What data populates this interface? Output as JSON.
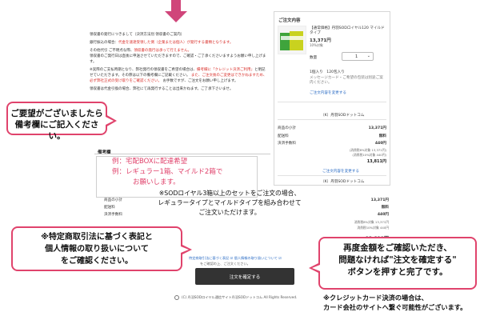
{
  "receipt_notice": {
    "title": "領収書の発行につきまして（決済方法別 領収書のご案内）",
    "bank_prefix": "銀行振込の場合：",
    "bank_red": "代金を速達受領した側（企業または個人）が発行する書類となります。",
    "bank_suffix": "",
    "cod_prefix": "その他代引 ご不明点な際、",
    "cod_red": "領収書の発行は承って行えません。",
    "cod_suffix": "",
    "line3": "領収書のご発行日は直後に申送させていただきますので、ご確認・ご了承くださいますようお願い申し上げます。",
    "line4_prefix": "※実際のご支払時期となり、弊社発行の領収書をご希望の場合は、",
    "line4_red": "備考欄に「クレジット決済ご利用」",
    "line4_suffix": "と明記せていただきます。その際は以下の備考欄にご記載ください。",
    "line5_red": "また、ご注文後のご変更はできかねますため、必ず弊社正式の受け取りをご確認ください。",
    "line6": "お手数ですが、ご注文をお願い申し上げます。",
    "line7": "領収書は代金引換の場合、弊社にて再発行することは出来かねます。ご了承下さいませ。"
  },
  "callouts": {
    "remarks_line1": "ご要望がございましたら",
    "remarks_line2": "備考欄にご記入ください。",
    "legal_line1": "※特定商取引法に基づく表記と",
    "legal_line2": "個人情報の取り扱いについて",
    "legal_line3": "をご確認ください。",
    "confirm_line1": "再度金額をご確認いただき、",
    "confirm_line2": "問題なければ\"注文を確定する\"",
    "confirm_line3": "ボタンを押すと完了です。",
    "card_note_line1": "※クレジットカード決済の場合は、",
    "card_note_line2": "カード会社のサイトへ繋ぐ可能性がございます。"
  },
  "order": {
    "title": "ご注文内容",
    "product_name": "【通常価格】丹羽SODロイヤル120 マイルドタイプ",
    "price": "13,371円",
    "tax_note": "10%対象",
    "qty_label": "数量",
    "qty_value": "1",
    "content": "1個入り　120包入り",
    "meta": "メッセージカード・ご希望の包装は別途ご案内ください。",
    "change_link": "ご注文内容を変更する",
    "store": "（K）丹羽SODドットコム",
    "subtotal_label": "商品の小計",
    "subtotal_value": "13,371円",
    "shipping_label": "配送料",
    "shipping_value": "無料",
    "fee_label": "決済手数料",
    "fee_value": "440円",
    "tax_line1": "(消費税8%対象 13,371円)",
    "tax_line2": "(消費税10%対象 440円)",
    "total_value": "13,811円",
    "change_link2": "ご注文内容を変更する",
    "store2": "（K）丹羽SODドットコム"
  },
  "remarks": {
    "heading": "備考欄",
    "ph_line1": "例：宅配BOXに配達希望",
    "ph_line2": "例：レギュラー1箱、マイルド2箱で",
    "ph_line3": "お願いします。"
  },
  "sodo_note": {
    "line1": "※SODロイヤル3箱以上のセットをご注文の場合、",
    "line2": "レギュラータイプとマイルドタイプを組み合わせて",
    "line3": "ご注文いただけます。"
  },
  "summary": {
    "subtotal_label": "商品の小計",
    "subtotal_value": "13,371円",
    "shipping_label": "配送料",
    "shipping_value": "無料",
    "fee_label": "決済手数料",
    "fee_value": "440円",
    "tax_line1": "消費税8%対象 13,371円",
    "tax_line2": "消費税10%対象 440円",
    "total_value": "13,811円"
  },
  "legal": {
    "links": "特定商取引法に基づく表記 ☑ 個人情報の取り扱いについて ☑",
    "agree": "をご確認の上、ご注文ください。",
    "confirm_button": "注文を確定する"
  },
  "footer": {
    "text": "(C) 丹羽SODロイヤル通信サイト丹羽SODドットコム All Rights Reserved."
  }
}
